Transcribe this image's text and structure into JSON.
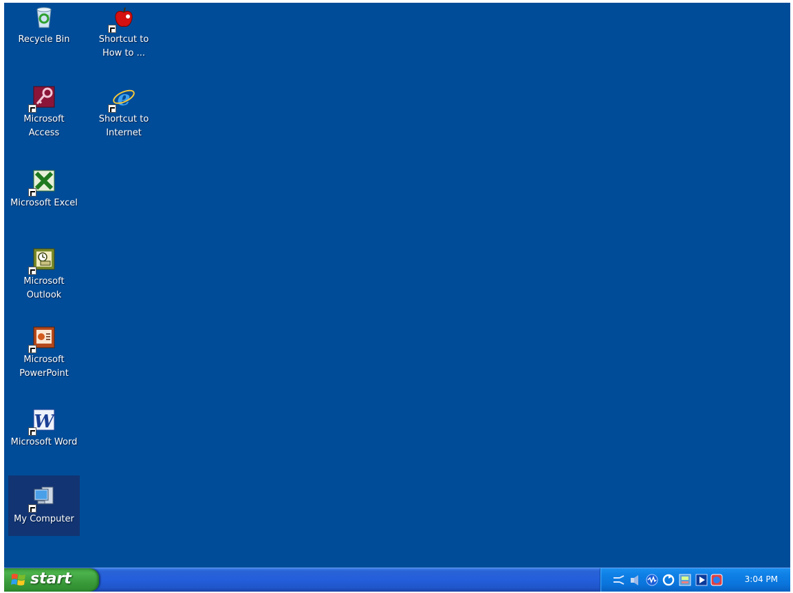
{
  "desktop": {
    "background_color": "#004c98",
    "icons": [
      {
        "label": "Recycle Bin",
        "icon": "recycle-bin-icon"
      },
      {
        "label": "Shortcut to\nHow to ...",
        "icon": "apple-icon"
      },
      {
        "label": "Microsoft\nAccess",
        "icon": "access-icon"
      },
      {
        "label": "Shortcut to\nInternet",
        "icon": "internet-explorer-icon"
      },
      {
        "label": "Microsoft Excel",
        "icon": "excel-icon"
      },
      {
        "label": "Microsoft\nOutlook",
        "icon": "outlook-icon"
      },
      {
        "label": "Microsoft\nPowerPoint",
        "icon": "powerpoint-icon"
      },
      {
        "label": "Microsoft Word",
        "icon": "word-icon"
      },
      {
        "label": "My Computer",
        "icon": "my-computer-icon"
      }
    ]
  },
  "taskbar": {
    "start_label": "start",
    "clock": "3:04 PM",
    "tray_icons": [
      "network-icon",
      "volume-icon",
      "messenger-icon",
      "sync-icon",
      "display-icon",
      "media-icon",
      "security-icon"
    ]
  }
}
